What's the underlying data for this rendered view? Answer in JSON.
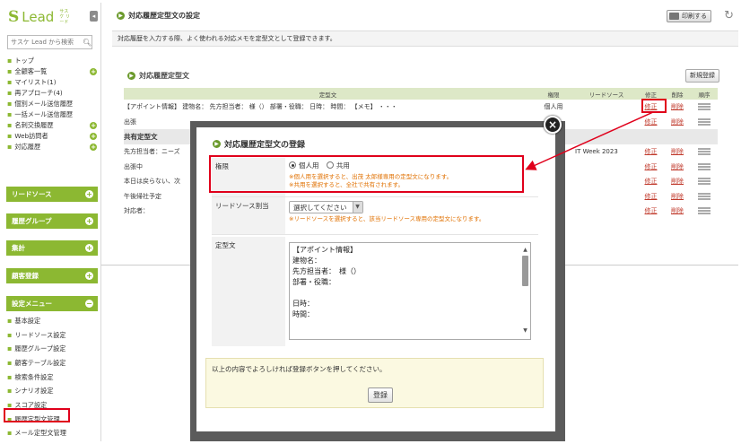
{
  "app": {
    "logo_mark": "S",
    "logo_name": "Lead",
    "logo_sub": "サスケ リード"
  },
  "sidebar": {
    "search_placeholder": "サスケ Lead から検索",
    "top_items": [
      {
        "label": "トップ",
        "plus": false
      },
      {
        "label": "全顧客一覧",
        "plus": true
      },
      {
        "label": "マイリスト(1)",
        "plus": false
      },
      {
        "label": "再アプローチ(4)",
        "plus": false
      },
      {
        "label": "個別メール送信履歴",
        "plus": false
      },
      {
        "label": "一括メール送信履歴",
        "plus": false
      },
      {
        "label": "名刺交換履歴",
        "plus": true
      },
      {
        "label": "Web訪問者",
        "plus": true
      },
      {
        "label": "対応履歴",
        "plus": true
      }
    ],
    "sections": [
      "リードソース",
      "履歴グループ",
      "集計",
      "顧客登録",
      "設定メニュー"
    ],
    "settings_items": [
      "基本設定",
      "リードソース設定",
      "履歴グループ設定",
      "顧客テーブル設定",
      "検索条件設定",
      "シナリオ設定",
      "スコア設定",
      "履歴定型文管理",
      "メール定型文管理"
    ]
  },
  "header": {
    "title": "対応履歴定型文の設定",
    "print_label": "印刷する",
    "description": "対応履歴を入力する際、よく使われる対応メモを定型文として登録できます。"
  },
  "list": {
    "section_title": "対応履歴定型文",
    "new_button": "新規登録",
    "columns": [
      "定型文",
      "権限",
      "リードソース",
      "修正",
      "削除",
      "順序"
    ],
    "rows": [
      {
        "text": "【アポイント情報】 建物名： 先方担当者： 様（） 部署・役職： 日時： 時間： 【メモ】 ・・・",
        "perm": "個人用",
        "source": "",
        "edit": "修正",
        "del": "削除"
      },
      {
        "text": "出張",
        "perm": "",
        "source": "",
        "edit": "修正",
        "del": "削除"
      }
    ],
    "group_label": "共有定型文",
    "shared_rows": [
      {
        "text": "先方担当者：ニーズ",
        "source": "IT Week 2023",
        "edit": "修正",
        "del": "削除"
      },
      {
        "text": "出張中",
        "source": "",
        "edit": "修正",
        "del": "削除"
      },
      {
        "text": "本日は戻らない、次",
        "source": "",
        "edit": "修正",
        "del": "削除"
      },
      {
        "text": "午後帰社予定",
        "source": "",
        "edit": "修正",
        "del": "削除"
      },
      {
        "text": "対応者：",
        "source": "",
        "edit": "修正",
        "del": "削除"
      }
    ]
  },
  "modal": {
    "title": "対応履歴定型文の登録",
    "close_label": "×",
    "perm_label": "権限",
    "perm_personal": "個人用",
    "perm_shared": "共用",
    "perm_note1": "※個人用を選択すると、出茂 太郎様専用の定型文になります。",
    "perm_note2": "※共用を選択すると、全社で共有されます。",
    "source_label": "リードソース割当",
    "source_select": "選択してください",
    "source_note": "※リードソースを選択すると、該当リードソース専用の定型文になります。",
    "text_label": "定型文",
    "text_value": "【アポイント情報】\n建物名：\n先方担当者：　様（）\n部署・役職：\n\n日時：\n時間：",
    "confirm_text": "以上の内容でよろしければ登録ボタンを押してください。",
    "register_label": "登録"
  },
  "colors": {
    "accent": "#8cb832",
    "highlight": "#e0001b",
    "link": "#c0392b",
    "note": "#e07000"
  }
}
